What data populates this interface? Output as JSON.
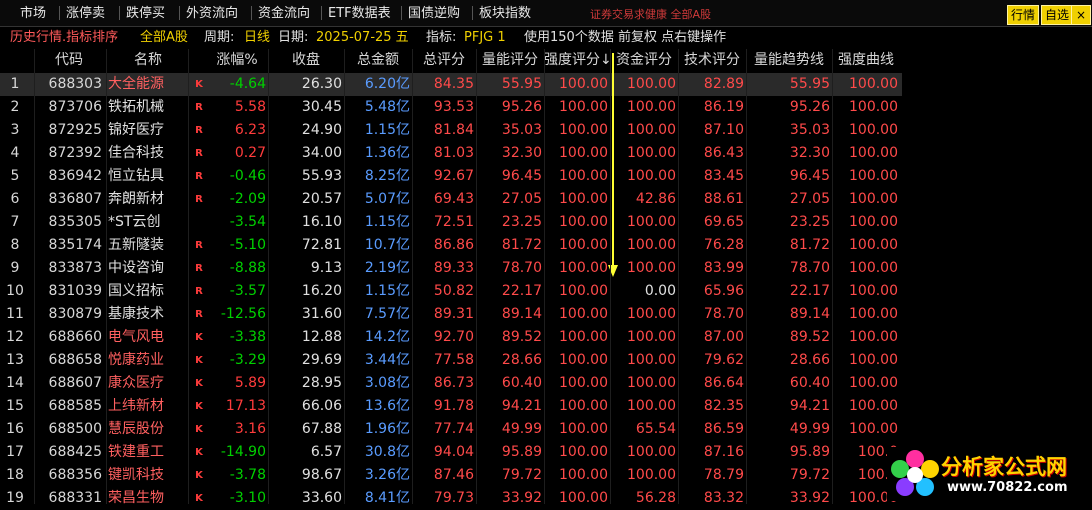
{
  "menu": {
    "items": [
      "市场",
      "涨停卖",
      "跌停买",
      "外资流向",
      "资金流向",
      "ETF数据表",
      "国债逆购",
      "板块指数"
    ],
    "watermark": "证券交易求健康 全部A股",
    "right_buttons": [
      "行情",
      "自选"
    ],
    "close_label": "×"
  },
  "info": {
    "title": "历史行情.指标排序",
    "market": "全部A股",
    "period_label": "周期:",
    "period_value": "日线",
    "date_label": "日期:",
    "date_value": "2025-07-25 五",
    "indicator_label": "指标:",
    "indicator_value": "PFJG 1",
    "note": "使用150个数据 前复权 点右键操作"
  },
  "table": {
    "columns": [
      "",
      "代码",
      "名称",
      "",
      "涨幅%",
      "收盘",
      "总金额",
      "总评分",
      "量能评分",
      "强度评分↓",
      "资金评分",
      "技术评分",
      "量能趋势线",
      "强度曲线"
    ],
    "rows": [
      [
        "1",
        "688303",
        "大全能源",
        "K",
        "-4.64",
        "26.30",
        "6.20亿",
        "84.35",
        "55.95",
        "100.00",
        "100.00",
        "82.89",
        "55.95",
        "100.00"
      ],
      [
        "2",
        "873706",
        "铁拓机械",
        "R",
        "5.58",
        "30.45",
        "5.48亿",
        "93.53",
        "95.26",
        "100.00",
        "100.00",
        "86.19",
        "95.26",
        "100.00"
      ],
      [
        "3",
        "872925",
        "锦好医疗",
        "R",
        "6.23",
        "24.90",
        "1.15亿",
        "81.84",
        "35.03",
        "100.00",
        "100.00",
        "87.10",
        "35.03",
        "100.00"
      ],
      [
        "4",
        "872392",
        "佳合科技",
        "R",
        "0.27",
        "34.00",
        "1.36亿",
        "81.03",
        "32.30",
        "100.00",
        "100.00",
        "86.43",
        "32.30",
        "100.00"
      ],
      [
        "5",
        "836942",
        "恒立钻具",
        "R",
        "-0.46",
        "55.93",
        "8.25亿",
        "92.67",
        "96.45",
        "100.00",
        "100.00",
        "83.45",
        "96.45",
        "100.00"
      ],
      [
        "6",
        "836807",
        "奔朗新材",
        "R",
        "-2.09",
        "20.57",
        "5.07亿",
        "69.43",
        "27.05",
        "100.00",
        "42.86",
        "88.61",
        "27.05",
        "100.00"
      ],
      [
        "7",
        "835305",
        "*ST云创",
        "",
        "-3.54",
        "16.10",
        "1.15亿",
        "72.51",
        "23.25",
        "100.00",
        "100.00",
        "69.65",
        "23.25",
        "100.00"
      ],
      [
        "8",
        "835174",
        "五新隧装",
        "R",
        "-5.10",
        "72.81",
        "10.7亿",
        "86.86",
        "81.72",
        "100.00",
        "100.00",
        "76.28",
        "81.72",
        "100.00"
      ],
      [
        "9",
        "833873",
        "中设咨询",
        "R",
        "-8.88",
        "9.13",
        "2.19亿",
        "89.33",
        "78.70",
        "100.00",
        "100.00",
        "83.99",
        "78.70",
        "100.00"
      ],
      [
        "10",
        "831039",
        "国义招标",
        "R",
        "-3.57",
        "16.20",
        "1.15亿",
        "50.82",
        "22.17",
        "100.00",
        "0.00",
        "65.96",
        "22.17",
        "100.00"
      ],
      [
        "11",
        "830879",
        "基康技术",
        "R",
        "-12.56",
        "31.60",
        "7.57亿",
        "89.31",
        "89.14",
        "100.00",
        "100.00",
        "78.70",
        "89.14",
        "100.00"
      ],
      [
        "12",
        "688660",
        "电气风电",
        "K",
        "-3.38",
        "12.88",
        "14.2亿",
        "92.70",
        "89.52",
        "100.00",
        "100.00",
        "87.00",
        "89.52",
        "100.00"
      ],
      [
        "13",
        "688658",
        "悦康药业",
        "K",
        "-3.29",
        "29.69",
        "3.44亿",
        "77.58",
        "28.66",
        "100.00",
        "100.00",
        "79.62",
        "28.66",
        "100.00"
      ],
      [
        "14",
        "688607",
        "康众医疗",
        "K",
        "5.89",
        "28.95",
        "3.08亿",
        "86.73",
        "60.40",
        "100.00",
        "100.00",
        "86.64",
        "60.40",
        "100.00"
      ],
      [
        "15",
        "688585",
        "上纬新材",
        "K",
        "17.13",
        "66.06",
        "13.6亿",
        "91.78",
        "94.21",
        "100.00",
        "100.00",
        "82.35",
        "94.21",
        "100.00"
      ],
      [
        "16",
        "688500",
        "慧辰股份",
        "K",
        "3.16",
        "67.88",
        "1.96亿",
        "77.74",
        "49.99",
        "100.00",
        "65.54",
        "86.59",
        "49.99",
        "100.00"
      ],
      [
        "17",
        "688425",
        "铁建重工",
        "K",
        "-14.90",
        "6.57",
        "30.8亿",
        "94.04",
        "95.89",
        "100.00",
        "100.00",
        "87.16",
        "95.89",
        "100.0"
      ],
      [
        "18",
        "688356",
        "键凯科技",
        "K",
        "-3.78",
        "98.67",
        "3.26亿",
        "87.46",
        "79.72",
        "100.00",
        "100.00",
        "78.79",
        "79.72",
        "100.0"
      ],
      [
        "19",
        "688331",
        "荣昌生物",
        "K",
        "-3.10",
        "33.60",
        "8.41亿",
        "79.73",
        "33.92",
        "100.00",
        "56.28",
        "83.32",
        "33.92",
        "100.00"
      ]
    ]
  },
  "colors": {
    "up": "#ff3c3c",
    "down": "#00d000",
    "amount": "#5a9cff",
    "score": "#ff4a4a",
    "info_yellow": "#f0d000",
    "arrow": "#ffff33"
  },
  "logo": {
    "name": "分析家公式网",
    "url": "www.70822.com"
  }
}
